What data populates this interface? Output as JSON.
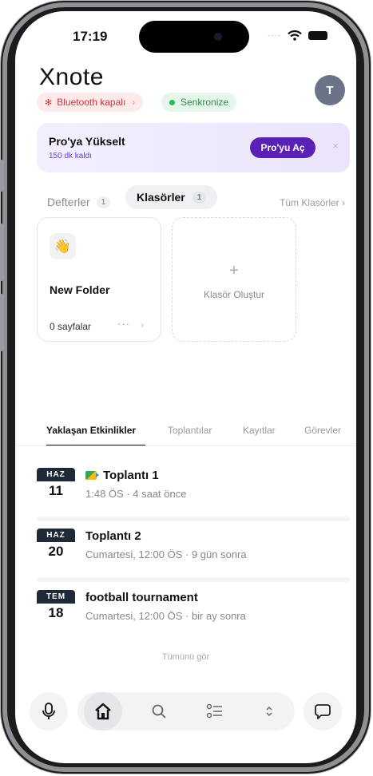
{
  "status_bar": {
    "time": "17:19"
  },
  "app": {
    "logo": "Xnote",
    "avatar_initial": "T"
  },
  "status_pills": {
    "bluetooth_label": "Bluetooth kapalı",
    "bluetooth_chevron": "›",
    "sync_label": "Senkronize"
  },
  "promo": {
    "title": "Pro'ya Yükselt",
    "subtitle": "150 dk kaldı",
    "button": "Pro'yu Aç",
    "close": "×"
  },
  "library_tabs": {
    "notebooks": {
      "label": "Defterler",
      "count": "1"
    },
    "folders": {
      "label": "Klasörler",
      "count": "1"
    },
    "all_folders": "Tüm Klasörler ›"
  },
  "folder": {
    "emoji": "👋",
    "name": "New Folder",
    "pages": "0 sayfalar",
    "more": "···",
    "chevron": "›"
  },
  "create_folder": {
    "plus": "+",
    "label": "Klasör Oluştur"
  },
  "event_tabs": {
    "upcoming": "Yaklaşan Etkinlikler",
    "meetings": "Toplantılar",
    "recordings": "Kayıtlar",
    "tasks": "Görevler"
  },
  "events": [
    {
      "month": "HAZ",
      "day": "11",
      "title": "Toplantı 1",
      "subtitle": "1:48 ÖS · 4 saat önce",
      "icon": "google-meet-icon"
    },
    {
      "month": "HAZ",
      "day": "20",
      "title": "Toplantı 2",
      "subtitle": "Cumartesi, 12:00 ÖS · 9 gün sonra"
    },
    {
      "month": "TEM",
      "day": "18",
      "title": "football tournament",
      "subtitle": "Cumartesi, 12:00 ÖS · bir ay sonra"
    }
  ],
  "see_all": "Tümünü gör",
  "bottom_nav": [
    "microphone-icon",
    "home-icon",
    "search-icon",
    "tasks-list-icon",
    "chevron-up-down-icon",
    "chat-icon"
  ],
  "colors": {
    "accent": "#5b21b6",
    "bluetooth_off": "#c73a3a",
    "sync_green": "#2eb85c",
    "date_header": "#1f2937"
  }
}
